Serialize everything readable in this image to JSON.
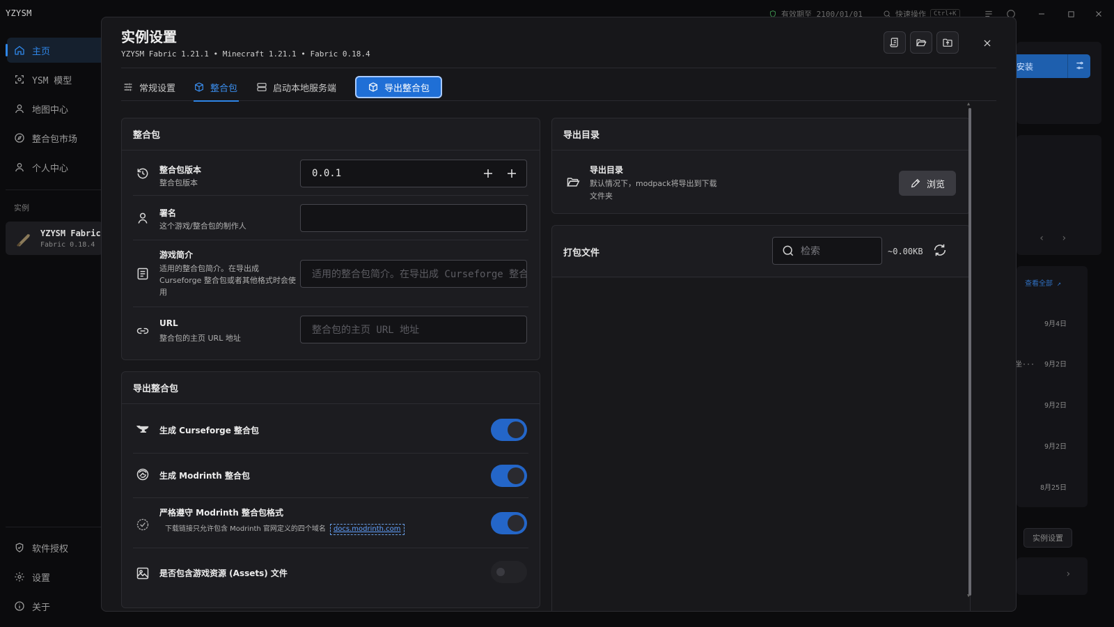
{
  "app": {
    "title": "YZYSM",
    "expiry": "有效期至 2100/01/01",
    "quick_action": "快速操作",
    "quick_action_key": "Ctrl+K"
  },
  "sidebar": {
    "items": [
      {
        "label": "主页",
        "icon": "home-icon",
        "active": true
      },
      {
        "label": "YSM 模型",
        "icon": "model-icon"
      },
      {
        "label": "地图中心",
        "icon": "map-user-icon"
      },
      {
        "label": "整合包市场",
        "icon": "compass-icon"
      },
      {
        "label": "个人中心",
        "icon": "user-icon"
      }
    ],
    "section_instances": "实例",
    "instance": {
      "name": "YZYSM Fabric",
      "version": "Fabric 0.18.4"
    },
    "bottom": [
      {
        "label": "软件授权",
        "icon": "shield-check-icon"
      },
      {
        "label": "设置",
        "icon": "gear-icon"
      },
      {
        "label": "关于",
        "icon": "info-icon"
      }
    ]
  },
  "background": {
    "install_label": "安装",
    "view_all": "查看全部 ↗",
    "truncated_text": "坐···",
    "dates": [
      "9月4日",
      "9月2日",
      "9月2日",
      "9月2日",
      "8月25日"
    ],
    "instance_settings_btn": "实例设置"
  },
  "dialog": {
    "title": "实例设置",
    "subtitle": "YZYSM Fabric 1.21.1 • Minecraft 1.21.1 • Fabric 0.18.4",
    "tabs": [
      {
        "label": "常规设置",
        "icon": "sliders-icon"
      },
      {
        "label": "整合包",
        "icon": "package-icon",
        "active": true
      },
      {
        "label": "启动本地服务端",
        "icon": "server-icon"
      }
    ],
    "export_tab_button": "导出整合包",
    "modpack": {
      "header": "整合包",
      "version": {
        "title": "整合包版本",
        "desc": "整合包版本",
        "value": "0.0.1"
      },
      "author": {
        "title": "署名",
        "desc": "这个游戏/整合包的制作人",
        "value": ""
      },
      "summary": {
        "title": "游戏简介",
        "desc": "适用的整合包简介。在导出成 Curseforge 整合包或者其他格式时会使用",
        "placeholder": "适用的整合包简介。在导出成 Curseforge 整合包或者其他格式时会使用"
      },
      "url": {
        "title": "URL",
        "desc": "整合包的主页 URL 地址",
        "placeholder": "整合包的主页 URL 地址"
      }
    },
    "export": {
      "header": "导出整合包",
      "curseforge": {
        "label": "生成 Curseforge 整合包",
        "on": true
      },
      "modrinth": {
        "label": "生成 Modrinth 整合包",
        "on": true
      },
      "strict": {
        "label": "严格遵守 Modrinth 整合包格式",
        "desc": "下载链接只允许包含 Modrinth 官网定义的四个域名",
        "link": "docs.modrinth.com",
        "on": true
      },
      "assets": {
        "label": "是否包含游戏资源 (Assets) 文件",
        "on": false
      }
    },
    "export_dir": {
      "header": "导出目录",
      "title": "导出目录",
      "desc_line1": "默认情况下，modpack将导出到下载",
      "desc_line2": "文件夹",
      "browse": "浏览"
    },
    "pack_files": {
      "header": "打包文件",
      "search_placeholder": "检索",
      "size": "~0.00KB"
    }
  },
  "colors": {
    "accent": "#2f86e8",
    "toggle_on": "#2466c8",
    "dialog_bg": "#17171a",
    "card_bg": "#1c1c20"
  }
}
